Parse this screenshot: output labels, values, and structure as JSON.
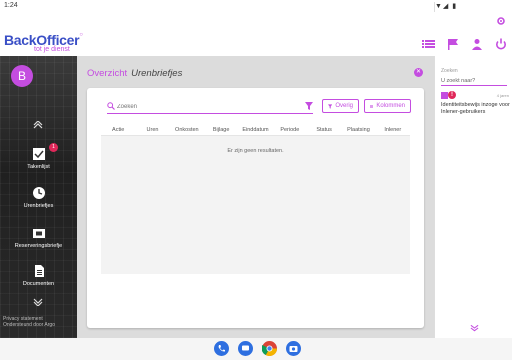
{
  "status": {
    "time": "1:24",
    "right": "▼◢ ▮"
  },
  "app": {
    "logo": "BackOffice",
    "logo_accent": "r",
    "tagline": "tot je dienst",
    "accent": "#c44de0",
    "brand": "#3a4fc6"
  },
  "sidebar": {
    "avatar_letter": "B",
    "user_line": "",
    "items": [
      {
        "label": "Takenlijst",
        "badge": "1",
        "icon": "checklist-icon"
      },
      {
        "label": "Urenbriefjes",
        "icon": "clock-icon"
      },
      {
        "label": "Reserveringsbriefje",
        "icon": "ticket-icon"
      },
      {
        "label": "Documenten",
        "icon": "document-icon"
      }
    ],
    "footer_line1": "Privacy statement",
    "footer_line2": "Ondersteund door Argo"
  },
  "main": {
    "crumb": "Overzicht",
    "title": "Urenbriefjes",
    "search_placeholder": "Zoeken",
    "buttons": {
      "overig": "Overig",
      "kolommen": "Kolommen"
    },
    "columns": [
      "Actie",
      "Uren",
      "Onkosten",
      "Bijlage",
      "Einddatum",
      "Periode",
      "Status",
      "Plaatsing",
      "Inlener"
    ],
    "empty_text": "Er zijn geen resultaten."
  },
  "right_panel": {
    "label": "Zoeken",
    "input_placeholder": "U zoekt naar?",
    "notification": {
      "meta": "4 jaren",
      "text": "Identiteitsbewijs inzoge voor Inlener-gebruikers"
    }
  }
}
